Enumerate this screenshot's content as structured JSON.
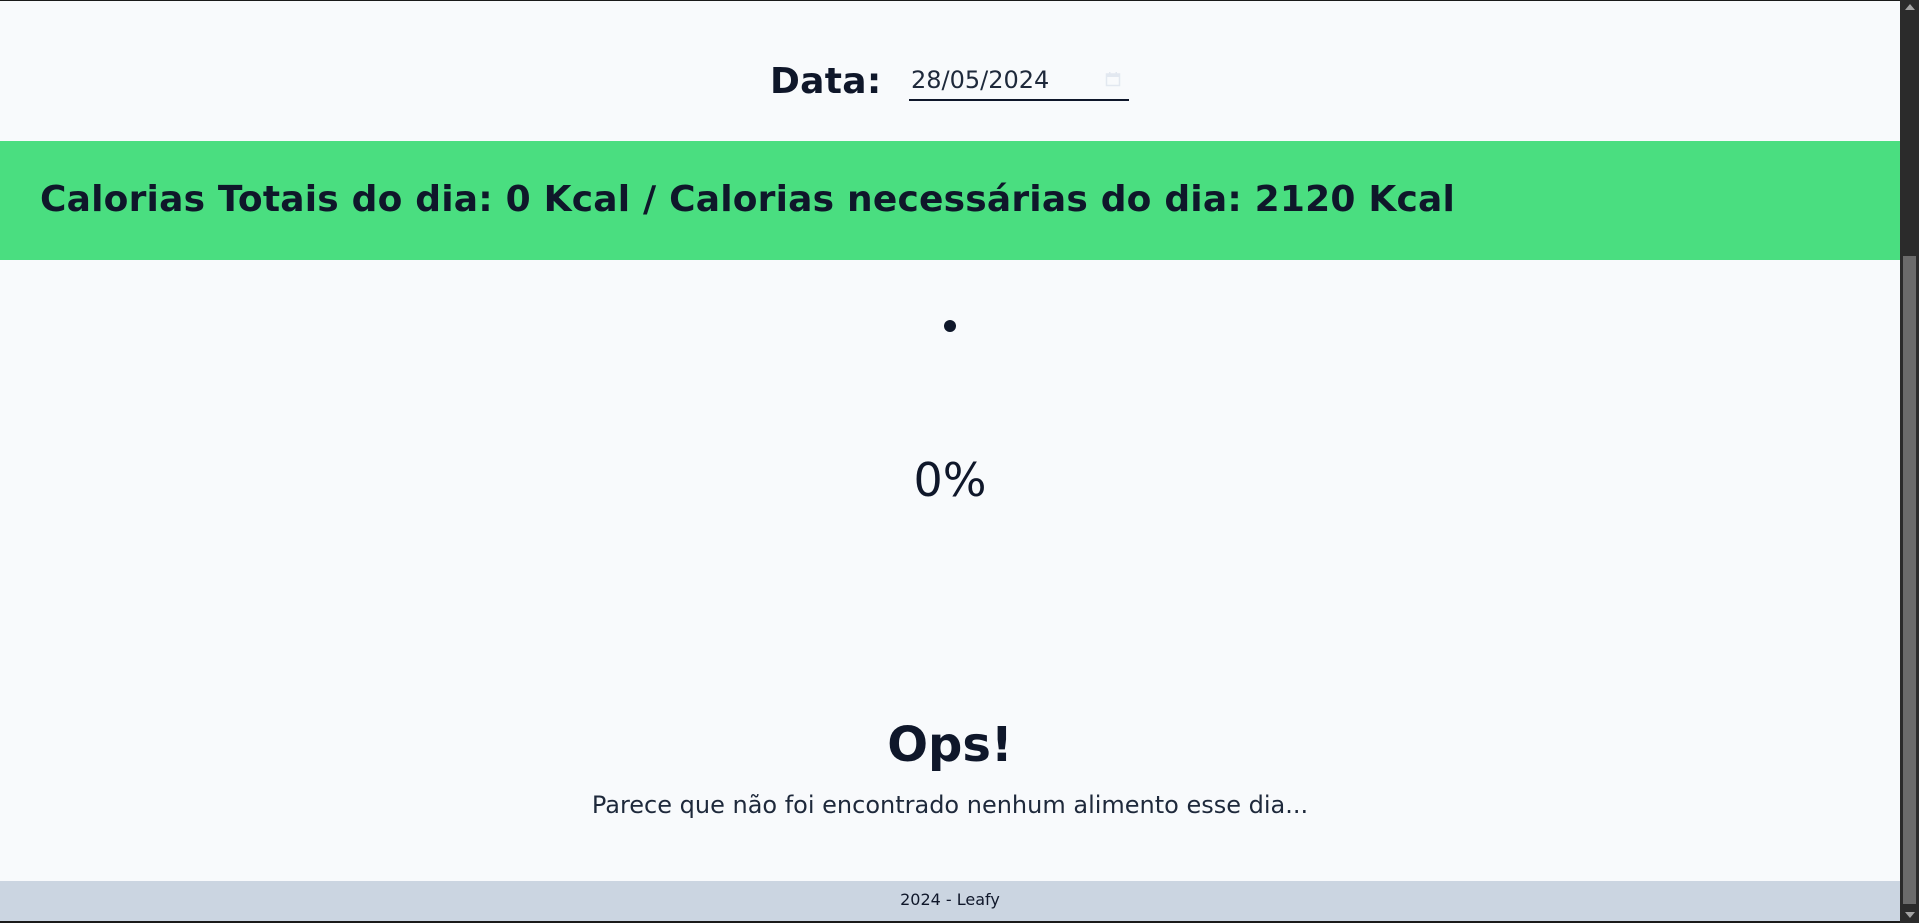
{
  "date_filter": {
    "label": "Data:",
    "value": "28/05/2024"
  },
  "summary": {
    "text": "Calorias Totais do dia: 0 Kcal / Calorias necessárias do dia: 2120 Kcal"
  },
  "progress": {
    "value_text": "0%",
    "fraction": 0
  },
  "empty_state": {
    "title": "Ops!",
    "message": "Parece que não foi encontrado nenhum alimento esse dia..."
  },
  "footer": {
    "text": "2024 - Leafy"
  },
  "colors": {
    "banner": "#4ade80",
    "background": "#f8fafc",
    "text": "#0f172a",
    "footer": "#cbd5e1"
  },
  "icons": {
    "date_picker": "calendar-icon"
  }
}
